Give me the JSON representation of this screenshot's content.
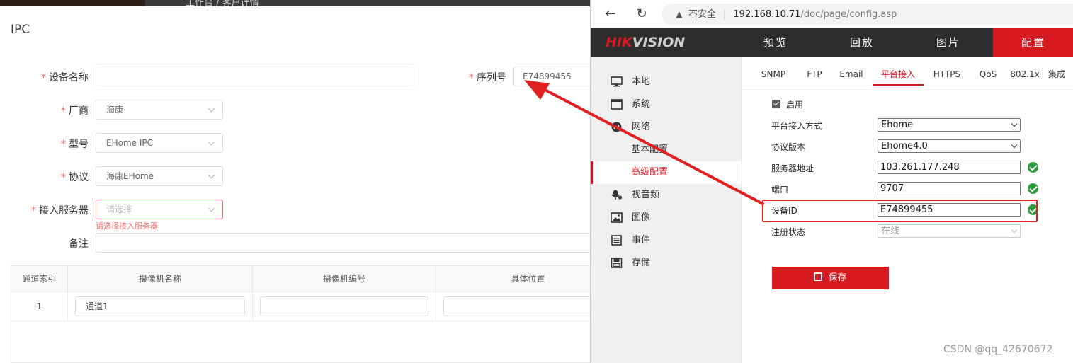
{
  "left_app": {
    "breadcrumb": "工作台 / 客户详情",
    "title": "IPC",
    "form": {
      "device_name": {
        "label": "设备名称",
        "value": ""
      },
      "serial": {
        "label": "序列号",
        "value": "E74899455"
      },
      "vendor": {
        "label": "厂商",
        "value": "海康"
      },
      "model": {
        "label": "型号",
        "value": "EHome IPC"
      },
      "protocol": {
        "label": "协议",
        "value": "海康EHome"
      },
      "server": {
        "label": "接入服务器",
        "placeholder": "请选择",
        "error": "请选择接入服务器"
      },
      "remark": {
        "label": "备注",
        "value": ""
      }
    },
    "table": {
      "columns": [
        "通道索引",
        "摄像机名称",
        "摄像机编号",
        "具体位置"
      ],
      "rows": [
        {
          "index": "1",
          "name": "通道1",
          "number": "",
          "location": ""
        }
      ]
    }
  },
  "browser": {
    "not_secure": "不安全",
    "url_host": "192.168.10.71",
    "url_path": "/doc/page/config.asp",
    "hik": {
      "logo_hik": "HIK",
      "logo_vision": "VISION",
      "main_tabs": [
        {
          "label": "预览",
          "active": false
        },
        {
          "label": "回放",
          "active": false
        },
        {
          "label": "图片",
          "active": false
        },
        {
          "label": "配置",
          "active": true
        }
      ],
      "sidebar": {
        "local": "本地",
        "system": "系统",
        "network": "网络",
        "network_basic": "基本配置",
        "network_advanced": "高级配置",
        "video_audio": "视音频",
        "image": "图像",
        "event": "事件",
        "storage": "存储"
      },
      "sub_tabs": [
        "SNMP",
        "FTP",
        "Email",
        "平台接入",
        "HTTPS",
        "QoS",
        "802.1x",
        "集成"
      ],
      "active_sub_tab": "平台接入",
      "config": {
        "enable_label": "启用",
        "access_mode_label": "平台接入方式",
        "access_mode_value": "Ehome",
        "protocol_version_label": "协议版本",
        "protocol_version_value": "Ehome4.0",
        "server_address_label": "服务器地址",
        "server_address_value": "103.261.177.248",
        "port_label": "端口",
        "port_value": "9707",
        "device_id_label": "设备ID",
        "device_id_value": "E74899455",
        "reg_status_label": "注册状态",
        "reg_status_value": "在线",
        "save_label": "保存"
      },
      "accent_color": "#d71920"
    }
  },
  "watermark": "CSDN @qq_42670672"
}
